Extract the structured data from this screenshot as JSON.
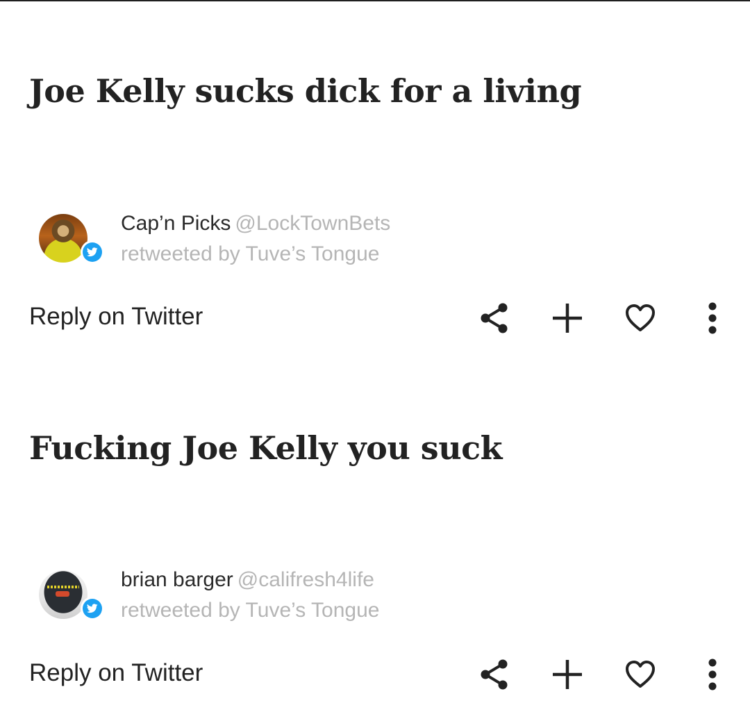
{
  "feed": {
    "items": [
      {
        "headline": "Joe Kelly sucks dick for a living",
        "author_name": "Cap’n Picks",
        "author_handle": "@LockTownBets",
        "retweet_text": "retweeted by Tuve’s Tongue",
        "reply_label": "Reply on Twitter",
        "icons": [
          "twitter-bird-icon",
          "share-icon",
          "plus-icon",
          "heart-icon",
          "more-vertical-icon"
        ]
      },
      {
        "headline": "Fucking Joe Kelly you suck",
        "author_name": "brian barger",
        "author_handle": "@califresh4life",
        "retweet_text": "retweeted by Tuve’s Tongue",
        "reply_label": "Reply on Twitter",
        "icons": [
          "twitter-bird-icon",
          "share-icon",
          "plus-icon",
          "heart-icon",
          "more-vertical-icon"
        ]
      }
    ]
  },
  "colors": {
    "text_primary": "#222222",
    "text_muted": "#b5b5b5",
    "twitter_blue": "#1da1f2",
    "background": "#ffffff"
  }
}
